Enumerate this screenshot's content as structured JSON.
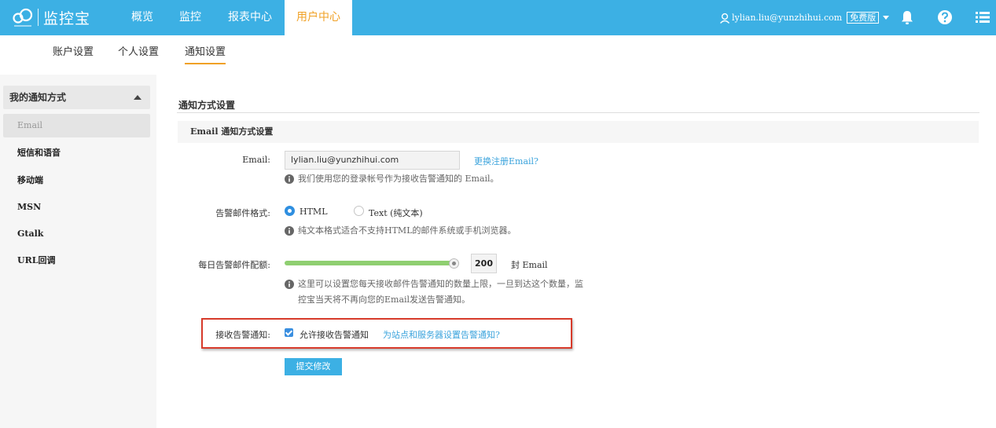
{
  "header": {
    "logo_text": "监控宝",
    "nav": [
      {
        "label": "概览"
      },
      {
        "label": "监控"
      },
      {
        "label": "报表中心"
      },
      {
        "label": "用户中心"
      }
    ],
    "user_email": "lylian.liu@yunzhihui.com",
    "plan_badge": "免费版",
    "icons": [
      "user-icon",
      "bell-icon",
      "help-icon",
      "menu-list-icon"
    ],
    "brand_color": "#3cb0e4",
    "active_color": "#f0a126"
  },
  "subtabs": [
    {
      "label": "账户设置"
    },
    {
      "label": "个人设置"
    },
    {
      "label": "通知设置"
    }
  ],
  "sidebar": {
    "header": "我的通知方式",
    "items": [
      {
        "label": "Email"
      },
      {
        "label": "短信和语音"
      },
      {
        "label": "移动端"
      },
      {
        "label": "MSN"
      },
      {
        "label": "Gtalk"
      },
      {
        "label": "URL回调"
      }
    ]
  },
  "main": {
    "section_title": "通知方式设置",
    "panel_title": "Email 通知方式设置",
    "email": {
      "label": "Email:",
      "value": "lylian.liu@yunzhihui.com",
      "change_link": "更换注册Email?",
      "hint": "我们使用您的登录帐号作为接收告警通知的 Email。"
    },
    "format": {
      "label": "告警邮件格式:",
      "options": [
        {
          "label": "HTML",
          "selected": true
        },
        {
          "label": "Text (纯文本)",
          "selected": false
        }
      ],
      "hint": "纯文本格式适合不支持HTML的邮件系统或手机浏览器。"
    },
    "quota": {
      "label": "每日告警邮件配额:",
      "value": "200",
      "level_fraction": 1.0,
      "unit": "封 Email",
      "hint_line1": "这里可以设置您每天接收邮件告警通知的数量上限，一旦到达这个数量，监",
      "hint_line2": "控宝当天将不再向您的Email发送告警通知。"
    },
    "receive": {
      "label": "接收告警通知:",
      "checkbox_label": "允许接收告警通知",
      "checked": true,
      "link": "为站点和服务器设置告警通知?"
    },
    "submit_label": "提交修改"
  }
}
